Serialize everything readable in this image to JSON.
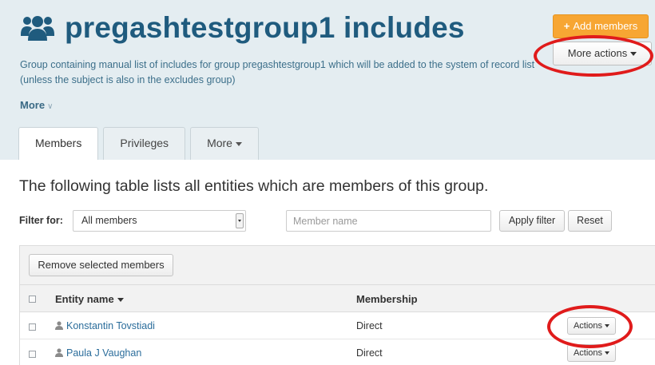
{
  "header": {
    "title": "pregashtestgroup1 includes",
    "description": "Group containing manual list of includes for group pregashtestgroup1 which will be added to the system of record list (unless the subject is also in the excludes group)",
    "more_label": "More",
    "add_members_label": "Add members",
    "more_actions_label": "More actions"
  },
  "tabs": [
    {
      "label": "Members"
    },
    {
      "label": "Privileges"
    },
    {
      "label": "More"
    }
  ],
  "intro_text": "The following table lists all entities which are members of this group.",
  "filter": {
    "label": "Filter for:",
    "selected": "All members",
    "member_placeholder": "Member name",
    "apply_label": "Apply filter",
    "reset_label": "Reset"
  },
  "table": {
    "remove_label": "Remove selected members",
    "columns": {
      "entity": "Entity name",
      "membership": "Membership"
    },
    "rows": [
      {
        "name": "Konstantin Tovstiadi",
        "membership": "Direct",
        "action": "Actions"
      },
      {
        "name": "Paula J Vaughan",
        "membership": "Direct",
        "action": "Actions"
      }
    ]
  },
  "colors": {
    "header_bg": "#e4edf1",
    "title": "#1f5b7e",
    "add_button": "#f7a633",
    "annotation": "#e01b1b",
    "link": "#2b6d9b"
  },
  "icons": {
    "group": "users-group-icon",
    "user": "user-icon",
    "plus": "plus-icon",
    "caret": "caret-down-icon"
  }
}
